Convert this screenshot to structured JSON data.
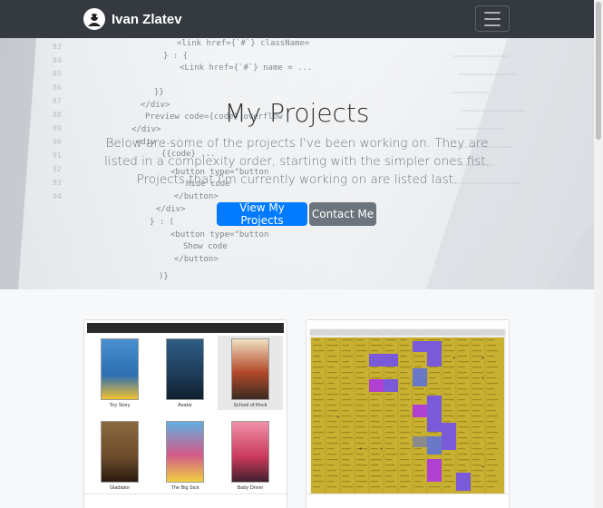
{
  "navbar": {
    "brand": "Ivan Zlatev",
    "brand_icon": "user-avatar-icon",
    "toggler_icon": "hamburger-menu-icon"
  },
  "hero": {
    "title": "My Projects",
    "lead": "Below are some of the projects I've been working on. They are listed in a complexity order, starting with the simpler ones fist. Projects that I'm currently working on are listed last.",
    "primary_button": "View My Projects",
    "secondary_button": "Contact Me",
    "background": "code-editor-photo"
  },
  "colors": {
    "navbar": "#343a40",
    "primary": "#007bff",
    "secondary": "#6c757d"
  },
  "cards": [
    {
      "posters": [
        {
          "title": "Toy Story",
          "color": "#2c6fb3"
        },
        {
          "title": "Avatar",
          "color": "#1f3b57"
        },
        {
          "title": "School of Rock",
          "color": "#b44a2a"
        },
        {
          "title": "Gladiator",
          "color": "#6a4a2a"
        },
        {
          "title": "The Big Sick",
          "color": "#d35a8a"
        },
        {
          "title": "Baby Driver",
          "color": "#c8385a"
        }
      ]
    },
    {
      "thumbnail": "spreadsheet-schedule-screenshot"
    }
  ]
}
